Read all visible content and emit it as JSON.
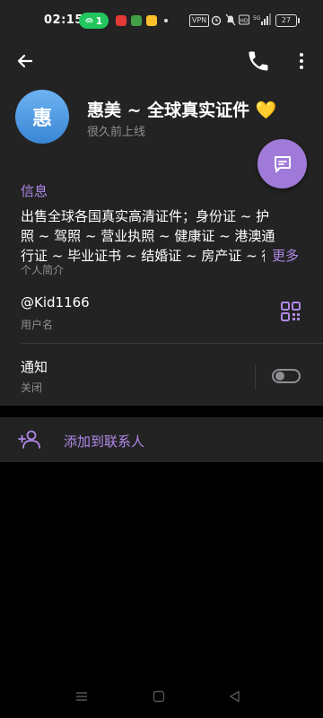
{
  "status_bar": {
    "time": "02:15",
    "pill_count": "1",
    "vpn": "VPN",
    "battery": "27",
    "accent_color": "#22c55e"
  },
  "profile": {
    "avatar_initial": "惠",
    "name": "惠美 ~ 全球真实证件",
    "name_emoji": "💛",
    "last_seen": "很久前上线"
  },
  "info": {
    "section_title": "信息",
    "bio": "出售全球各国真实高清证件；身份证 ~ 护照 ~ 驾照 ~ 营业执照 ~ 健康证 ~ 港澳通行证 ~ 毕业证书 ~ 结婚证 ~ 房产证 ~ 行驶证等",
    "more_label": "更多",
    "bio_caption": "个人简介",
    "username": "@Kid1166",
    "username_caption": "用户名",
    "notifications_label": "通知",
    "notifications_status": "关闭",
    "notifications_enabled": false
  },
  "actions": {
    "add_contact_label": "添加到联系人"
  },
  "colors": {
    "accent": "#b088e8",
    "fab": "#a07ad8",
    "card": "#232323",
    "secondary_text": "#8e8e93"
  },
  "icons": [
    "back-arrow-icon",
    "phone-icon",
    "more-vertical-icon",
    "chat-icon",
    "qr-code-icon",
    "add-person-icon",
    "menu-icon",
    "home-square-icon",
    "back-triangle-icon"
  ]
}
